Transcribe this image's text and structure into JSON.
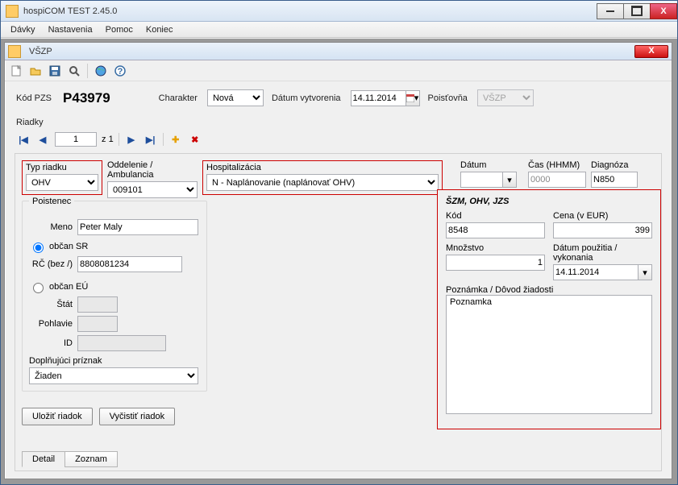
{
  "outerTitle": "hospiCOM TEST 2.45.0",
  "menu": {
    "davky": "Dávky",
    "nastavenia": "Nastavenia",
    "pomoc": "Pomoc",
    "koniec": "Koniec"
  },
  "childTitle": "VŠZP",
  "toolbar": {
    "new": "new-icon",
    "open": "open-icon",
    "save": "save-icon",
    "search": "search-icon",
    "globe": "globe-icon",
    "help": "help-icon"
  },
  "header": {
    "kodPzsLabel": "Kód PZS",
    "kodPzsValue": "P43979",
    "charakterLabel": "Charakter",
    "charakterValue": "Nová",
    "datumVytvLabel": "Dátum vytvorenia",
    "datumVytvValue": "14.11.2014",
    "poistovnaLabel": "Poisťovňa",
    "poistovnaValue": "VŠZP"
  },
  "riadkyLabel": "Riadky",
  "nav": {
    "page": "1",
    "ofPrefix": "z",
    "total": "1"
  },
  "row1": {
    "typRiadkuLabel": "Typ riadku",
    "typRiadkuValue": "OHV",
    "oddelLabel": "Oddelenie / Ambulancia",
    "oddelValue": "009101",
    "hospLabel": "Hospitalizácia",
    "hospValue": "N - Naplánovanie (naplánovať OHV)",
    "datumLabel": "Dátum",
    "datumValue": "",
    "casLabel": "Čas (HHMM)",
    "casValue": "0000",
    "diagLabel": "Diagnóza",
    "diagValue": "N850"
  },
  "poistenec": {
    "title": "Poistenec",
    "menoLabel": "Meno",
    "menoValue": "Peter Maly",
    "obcanSR": "občan SR",
    "rcLabel": "RČ (bez /)",
    "rcValue": "8808081234",
    "obcanEU": "občan EÚ",
    "statLabel": "Štát",
    "statValue": "",
    "pohlavieLabel": "Pohlavie",
    "pohlavieValue": "",
    "idLabel": "ID",
    "idValue": "",
    "doplnLabel": "Doplňujúci príznak",
    "doplnValue": "Žiaden"
  },
  "actions": {
    "ulozit": "Uložiť riadok",
    "vycistit": "Vyčistiť riadok"
  },
  "szm": {
    "title": "ŠZM, OHV, JZS",
    "kodLabel": "Kód",
    "kodValue": "8548",
    "cenaLabel": "Cena (v EUR)",
    "cenaValue": "399",
    "mnozLabel": "Množstvo",
    "mnozValue": "1",
    "datPouzLabel": "Dátum použitia / vykonania",
    "datPouzValue": "14.11.2014",
    "poznLabel": "Poznámka / Dôvod žiadosti",
    "poznValue": "Poznamka"
  },
  "tabs": {
    "detail": "Detail",
    "zoznam": "Zoznam"
  }
}
